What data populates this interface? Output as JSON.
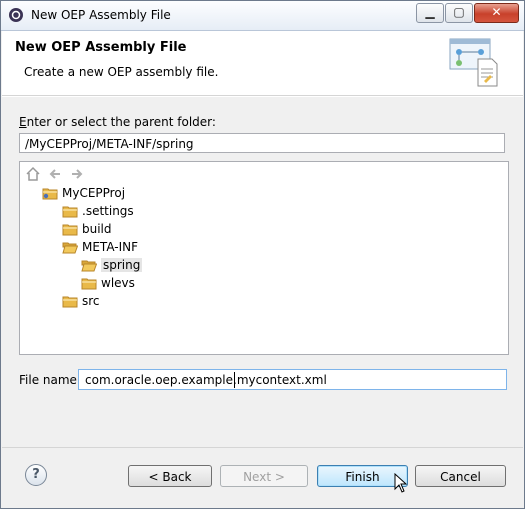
{
  "window": {
    "title": "New OEP Assembly File",
    "controls": {
      "minimize": "▁",
      "maximize": "▢",
      "close": "✕"
    }
  },
  "banner": {
    "title": "New OEP Assembly File",
    "subtitle": "Create a new OEP assembly file.",
    "icon": "wizard-banner-icon"
  },
  "folder": {
    "label_prefix": "E",
    "label_rest": "nter or select the parent folder:",
    "value": "/MyCEPProj/META-INF/spring"
  },
  "tree": {
    "toolbar": [
      "home-icon",
      "back-arrow-icon",
      "forward-arrow-icon"
    ],
    "nodes": [
      {
        "label": "MyCEPProj",
        "icon": "project-folder-icon",
        "selected": false
      },
      {
        "label": ".settings",
        "icon": "folder-icon",
        "selected": false
      },
      {
        "label": "build",
        "icon": "folder-icon",
        "selected": false
      },
      {
        "label": "META-INF",
        "icon": "folder-open-icon",
        "selected": false
      },
      {
        "label": "spring",
        "icon": "folder-open-icon",
        "selected": true
      },
      {
        "label": "wlevs",
        "icon": "folder-icon",
        "selected": false
      },
      {
        "label": "src",
        "icon": "folder-icon",
        "selected": false
      }
    ]
  },
  "file_name": {
    "label": "File name:",
    "value": "com.oracle.oep.example.mycontext.xml"
  },
  "buttons": {
    "help": "?",
    "back": "< Back",
    "next": "Next >",
    "finish": "Finish",
    "cancel": "Cancel"
  },
  "colors": {
    "folder": "#e9b949",
    "accent": "#3c7fb1"
  }
}
